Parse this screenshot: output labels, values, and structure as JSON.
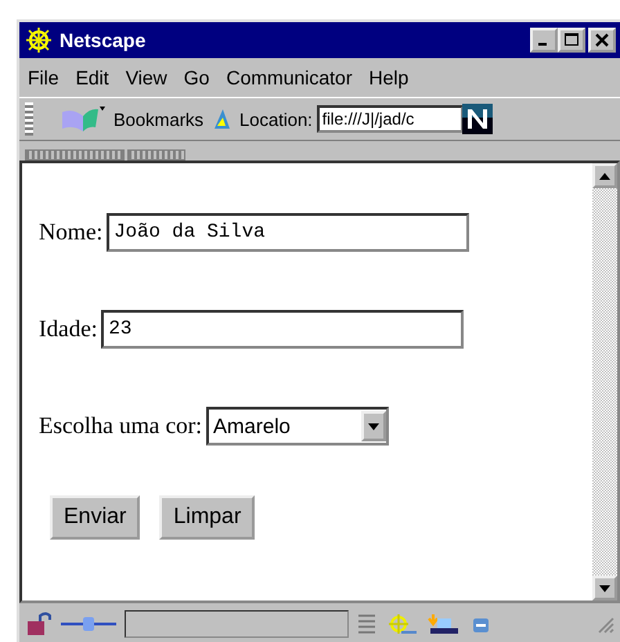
{
  "window": {
    "title": "Netscape"
  },
  "menu": [
    "File",
    "Edit",
    "View",
    "Go",
    "Communicator",
    "Help"
  ],
  "toolbar": {
    "bookmarks": "Bookmarks",
    "location_label": "Location:",
    "location_value": "file:///J|/jad/c"
  },
  "form": {
    "fields": [
      {
        "kind": "text",
        "label": "Nome:",
        "value": "João da Silva"
      },
      {
        "kind": "text",
        "label": "Idade:",
        "value": "23"
      },
      {
        "kind": "select",
        "label": "Escolha uma cor:",
        "value": "Amarelo"
      }
    ],
    "buttons": [
      "Enviar",
      "Limpar"
    ]
  }
}
